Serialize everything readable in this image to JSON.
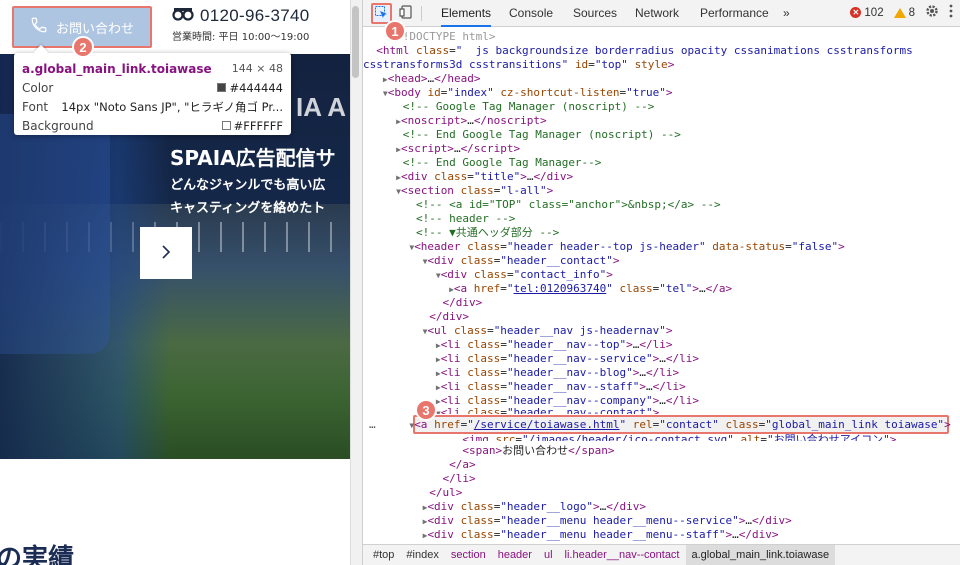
{
  "page": {
    "contact_button": "お問い合わせ",
    "tel_number": "0120-96-3740",
    "tel_hours": "営業時間: 平日 10:00〜19:00",
    "hero_ghost": "IA A",
    "hero_title": "SPAIA広告配信サ",
    "hero_sub_1": "どんなジャンルでも高い広",
    "hero_sub_2": "キャスティングを絡めたト",
    "section_heading": "の実績"
  },
  "tooltip": {
    "selector": "a.global_main_link.toiawase",
    "dimensions": "144 × 48",
    "rows": [
      {
        "label": "Color",
        "value": "#444444",
        "swatch": "#444444"
      },
      {
        "label": "Font",
        "value": "14px \"Noto Sans JP\", \"ヒラギノ角ゴ Pr..."
      },
      {
        "label": "Background",
        "value": "#FFFFFF",
        "swatch": "#FFFFFF"
      }
    ]
  },
  "badges": {
    "one": "1",
    "two": "2",
    "three": "3"
  },
  "devtools": {
    "tabs": [
      "Elements",
      "Console",
      "Sources",
      "Network",
      "Performance",
      "»"
    ],
    "errors": "102",
    "warnings": "8",
    "breadcrumbs": [
      "#top",
      "#index",
      "section",
      "header",
      "ul",
      "li.header__nav--contact",
      "a.global_main_link.toiawase"
    ]
  },
  "colors": {
    "accent": "#e9766c",
    "button_bg": "#aec5e1",
    "heading_blue": "#1b2d55"
  },
  "icons": [
    "phone-icon",
    "freedial-icon",
    "chevron-right-icon",
    "inspect-icon",
    "device-toolbar-icon",
    "error-icon",
    "warning-icon",
    "settings-gear-icon",
    "more-vertical-icon"
  ]
}
